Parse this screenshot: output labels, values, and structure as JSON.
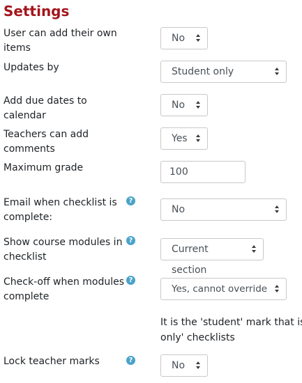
{
  "heading": "Settings",
  "help_glyph": "?",
  "fields": {
    "add_own_items": {
      "label": "User can add their own items",
      "value": "No"
    },
    "updates_by": {
      "label": "Updates by",
      "value": "Student only"
    },
    "due_dates": {
      "label": "Add due dates to calendar",
      "value": "No"
    },
    "teacher_comments": {
      "label": "Teachers can add comments",
      "value": "Yes"
    },
    "max_grade": {
      "label": "Maximum grade",
      "value": "100"
    },
    "email_complete": {
      "label_line1": "Email when checklist is",
      "label_line2": "complete:",
      "value": "No"
    },
    "show_modules": {
      "label_line1": "Show course modules in",
      "label_line2": "checklist",
      "value": "Current section"
    },
    "checkoff_modules": {
      "label_line1": "Check-off when modules",
      "label_line2": "complete",
      "value": "Yes, cannot override",
      "note_line1": "It is the 'student' mark that is a",
      "note_line2": "only' checklists"
    },
    "lock_teacher_marks": {
      "label": "Lock teacher marks",
      "value": "No"
    }
  },
  "colors": {
    "heading": "#a3161c",
    "help_icon": "#4aa3c9"
  }
}
